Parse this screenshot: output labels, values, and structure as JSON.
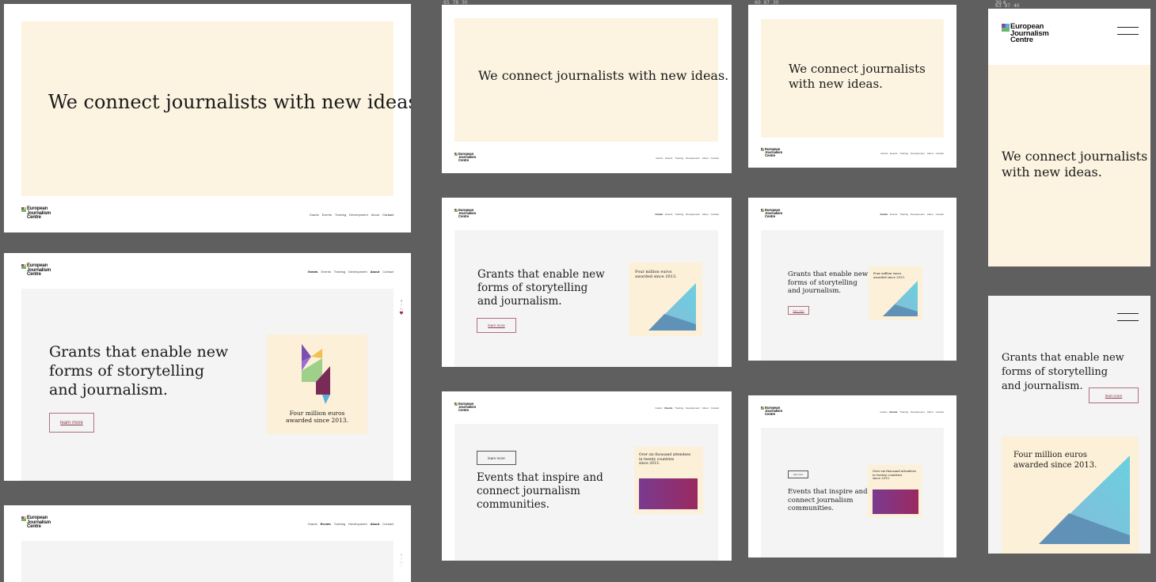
{
  "brand": {
    "logo_text": [
      "European",
      "Journalism",
      "Centre"
    ],
    "colors": {
      "mark_green": "#6db56d",
      "mark_purple": "#7a4fb0",
      "mark_yellow": "#f0c050",
      "mark_blue": "#5ab0d8"
    }
  },
  "nav": [
    "Grants",
    "Events",
    "Training",
    "Development",
    "About",
    "Contact"
  ],
  "hero": {
    "headline": "We connect journalists with new ideas.",
    "headline_line1": "We connect journalists",
    "headline_line2": "with new ideas."
  },
  "grants": {
    "lines": [
      "Grants that enable new",
      "forms of storytelling",
      "and journalism."
    ],
    "button": "learn more",
    "card": [
      "Four million euros",
      "awarded since 2013."
    ]
  },
  "events": {
    "lines": [
      "Events that inspire and",
      "connect journalism",
      "communities."
    ],
    "button": "learn more",
    "card": [
      "Over six thousand attendees",
      "in twenty countries",
      "since 2013."
    ]
  },
  "social_icons": [
    "twitter-icon",
    "facebook-icon",
    "linkedin-icon",
    "heart-icon"
  ],
  "ruler_labels": {
    "col2": [
      "65",
      "78",
      "30"
    ],
    "col3": [
      "60",
      "97",
      "30"
    ],
    "col4": [
      "63",
      "97",
      "40"
    ],
    "col4_top": "30.4"
  }
}
